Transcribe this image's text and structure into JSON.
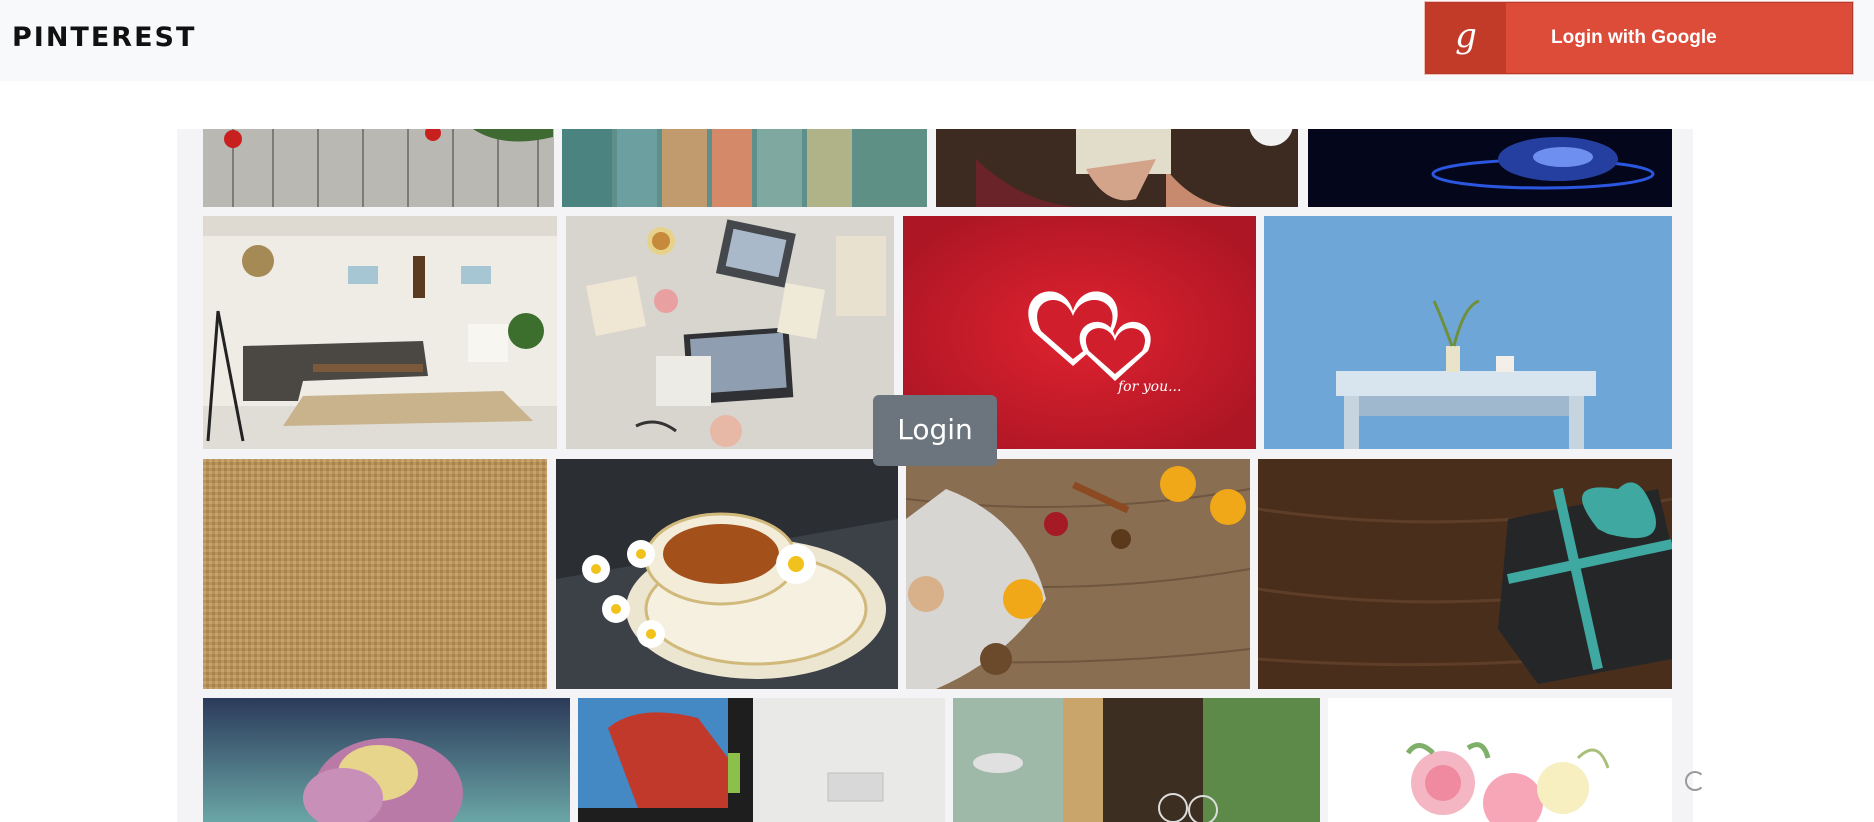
{
  "navbar": {
    "brand": "PINTEREST",
    "login_google": {
      "icon_glyph": "g",
      "label": "Login with Google",
      "color": "#dd4b39"
    }
  },
  "overlay": {
    "login_label": "Login"
  },
  "gallery": {
    "images": [
      "Christmas decorations on weathered grey wooden planks",
      "Painted multicolor wooden planks",
      "Hands holding a wrapped gift on a wooden table",
      "Blue sparkling galaxy on dark background",
      "Bright living room with grey sofa and plants",
      "Desk with laptop, gift wrapping and craft supplies",
      "Two white hearts on red background",
      "White table against a blue wall with a plant",
      "Burlap fabric texture",
      "Cup of tea with chamomile flowers",
      "Dried orange slices, cinnamon and pine cones on wood",
      "Black gift box with teal ribbon on dark wood",
      "Pink frosted rose on teal background",
      "Computer monitor showing a red bridge",
      "Restaurant terrace with wine glasses",
      "Watercolor pink flowers on white"
    ],
    "heart_caption": "for you..."
  }
}
